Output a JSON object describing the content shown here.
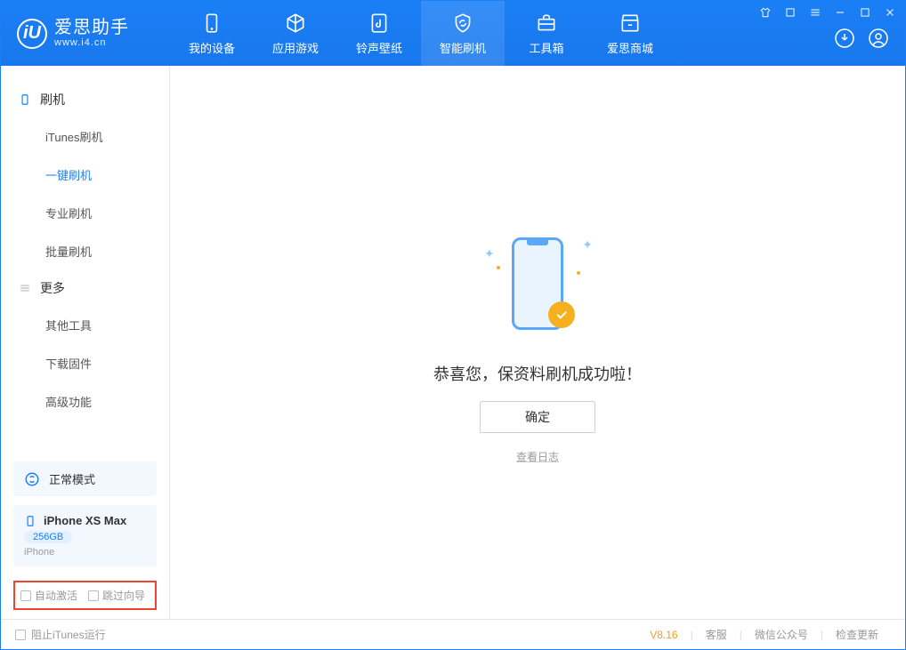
{
  "app": {
    "logo_letter": "iU",
    "logo_title": "爱思助手",
    "logo_sub": "www.i4.cn"
  },
  "nav": {
    "tabs": [
      {
        "label": "我的设备"
      },
      {
        "label": "应用游戏"
      },
      {
        "label": "铃声壁纸"
      },
      {
        "label": "智能刷机"
      },
      {
        "label": "工具箱"
      },
      {
        "label": "爱思商城"
      }
    ]
  },
  "sidebar": {
    "groups": [
      {
        "header": "刷机",
        "items": [
          "iTunes刷机",
          "一键刷机",
          "专业刷机",
          "批量刷机"
        ],
        "active_index": 1
      },
      {
        "header": "更多",
        "items": [
          "其他工具",
          "下载固件",
          "高级功能"
        ],
        "active_index": -1
      }
    ],
    "mode_label": "正常模式",
    "device_name": "iPhone XS Max",
    "device_capacity": "256GB",
    "device_type": "iPhone",
    "checkbox1": "自动激活",
    "checkbox2": "跳过向导"
  },
  "main": {
    "success_text": "恭喜您，保资料刷机成功啦！",
    "ok_button": "确定",
    "log_link": "查看日志"
  },
  "status": {
    "stop_itunes": "阻止iTunes运行",
    "version": "V8.16",
    "links": [
      "客服",
      "微信公众号",
      "检查更新"
    ]
  }
}
